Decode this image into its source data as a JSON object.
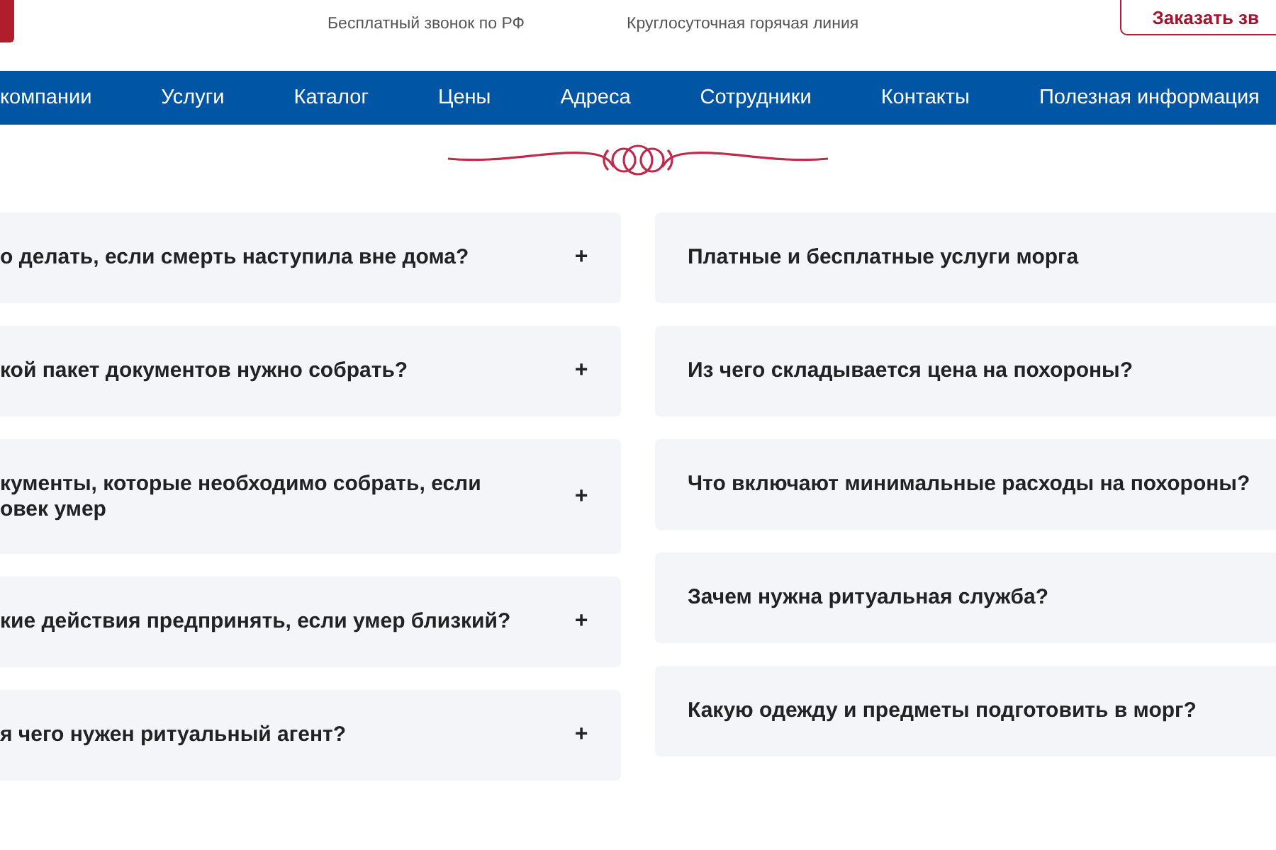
{
  "header": {
    "phones": [
      {
        "caption": "Бесплатный звонок по РФ"
      },
      {
        "caption": "Круглосуточная горячая линия"
      }
    ],
    "order_button": "Заказать зв"
  },
  "nav": {
    "items": [
      "компании",
      "Услуги",
      "Каталог",
      "Цены",
      "Адреса",
      "Сотрудники",
      "Контакты",
      "Полезная информация"
    ]
  },
  "faq": {
    "left": [
      {
        "question": "о делать, если смерть наступила вне дома?",
        "toggle": "+"
      },
      {
        "question": "кой пакет документов нужно собрать?",
        "toggle": "+"
      },
      {
        "question": "кументы, которые необходимо собрать, если\nовек умер",
        "toggle": "+"
      },
      {
        "question": "кие действия предпринять, если умер близкий?",
        "toggle": "+"
      },
      {
        "question": "я чего нужен ритуальный агент?",
        "toggle": "+"
      }
    ],
    "right": [
      {
        "question": "Платные и бесплатные услуги морга"
      },
      {
        "question": "Из чего складывается цена на похороны?"
      },
      {
        "question": "Что включают минимальные расходы на похороны?"
      },
      {
        "question": "Зачем нужна ритуальная служба?"
      },
      {
        "question": "Какую одежду и предметы подготовить в морг?"
      }
    ]
  }
}
